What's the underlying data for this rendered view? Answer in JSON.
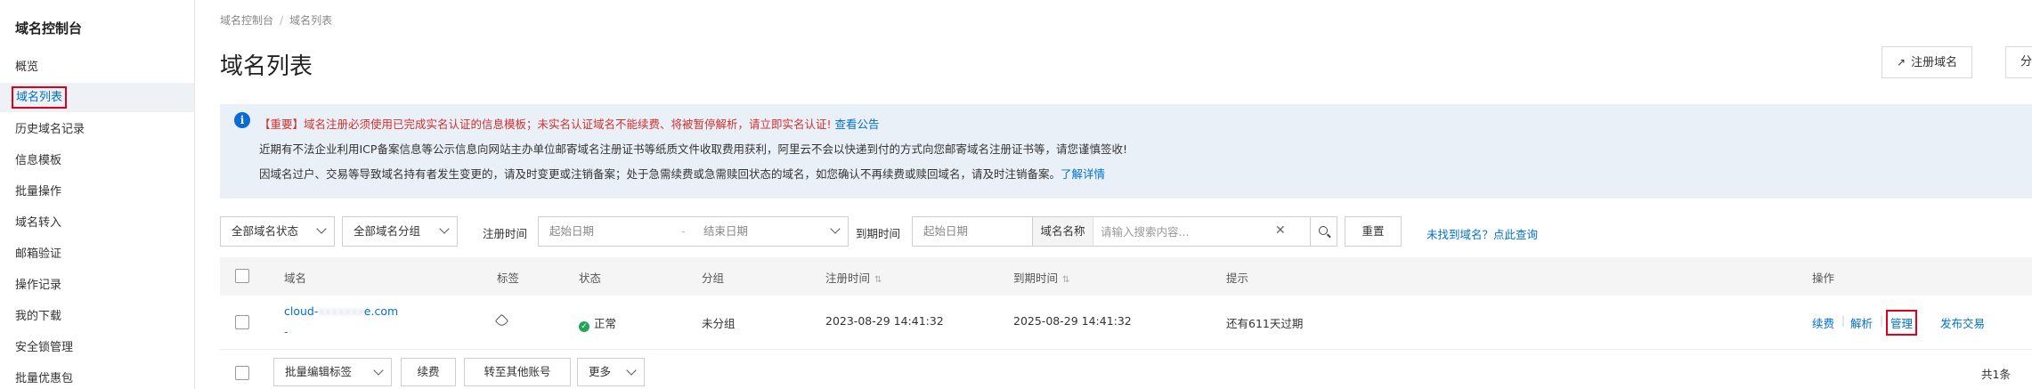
{
  "sidebar": {
    "title": "域名控制台",
    "items": [
      {
        "label": "概览"
      },
      {
        "label": "域名列表"
      },
      {
        "label": "历史域名记录"
      },
      {
        "label": "信息模板"
      },
      {
        "label": "批量操作"
      },
      {
        "label": "域名转入"
      },
      {
        "label": "邮箱验证"
      },
      {
        "label": "操作记录"
      },
      {
        "label": "我的下载"
      },
      {
        "label": "安全锁管理"
      },
      {
        "label": "批量优惠包"
      }
    ]
  },
  "breadcrumb": {
    "root": "域名控制台",
    "separator": "/",
    "current": "域名列表"
  },
  "page_title": "域名列表",
  "header_buttons": {
    "register": "注册域名",
    "group": "分组"
  },
  "notice": {
    "line1_text": "【重要】域名注册必须使用已完成实名认证的信息模板；未实名认证域名不能续费、将被暂停解析，请立即实名认证!",
    "line1_link": "查看公告",
    "line2_text": "近期有不法企业利用ICP备案信息等公示信息向网站主办单位邮寄域名注册证书等纸质文件收取费用获利，阿里云不会以快递到付的方式向您邮寄域名注册证书等，请您谨慎签收!",
    "line3_text": "因域名过户、交易等导致域名持有者发生变更的，请及时变更或注销备案；处于急需续费或急需赎回状态的域名，如您确认不再续费或赎回域名，请及时注销备案。",
    "line3_link": "了解详情"
  },
  "filters": {
    "status": "全部域名状态",
    "group": "全部域名分组",
    "reg_label": "注册时间",
    "exp_label": "到期时间",
    "start_placeholder": "起始日期",
    "end_placeholder": "结束日期",
    "search_label": "域名名称",
    "search_placeholder": "请输入搜索内容...",
    "reset": "重置",
    "not_found": "未找到域名？点此查询"
  },
  "table": {
    "headers": {
      "domain": "域名",
      "tag": "标签",
      "status": "状态",
      "group": "分组",
      "reg_time": "注册时间",
      "exp_time": "到期时间",
      "hint": "提示",
      "ops": "操作"
    },
    "rows": [
      {
        "domain": "cloud-",
        "domain_rest": "e.com",
        "sub": "-",
        "status": "正常",
        "group": "未分组",
        "reg_time": "2023-08-29 14:41:32",
        "exp_time": "2025-08-29 14:41:32",
        "hint": "还有611天过期",
        "ops": {
          "renew": "续费",
          "resolve": "解析",
          "manage": "管理",
          "trade": "发布交易"
        }
      }
    ]
  },
  "bottom": {
    "batch_tag": "批量编辑标签",
    "renew": "续费",
    "transfer": "转至其他账号",
    "more": "更多",
    "total": "共1条"
  },
  "colors": {
    "link": "#0070cc",
    "highlight_box": "#e0001b",
    "status_ok": "#23a55a",
    "notice_bg": "#eaf0f8"
  }
}
